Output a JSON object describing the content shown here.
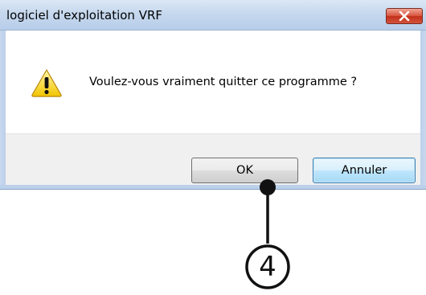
{
  "dialog": {
    "title": "logiciel d'exploitation VRF",
    "close_icon": "close-icon",
    "message_icon": "warning-icon",
    "message": "Voulez-vous vraiment quitter ce programme ?",
    "ok_label": "OK",
    "cancel_label": "Annuler"
  },
  "annotation": {
    "step_number": "4"
  },
  "colors": {
    "titlebar": "#c6d8ee",
    "close_button": "#c2301b",
    "button_bar": "#f0f0f0",
    "default_button": "#bee6fd"
  }
}
